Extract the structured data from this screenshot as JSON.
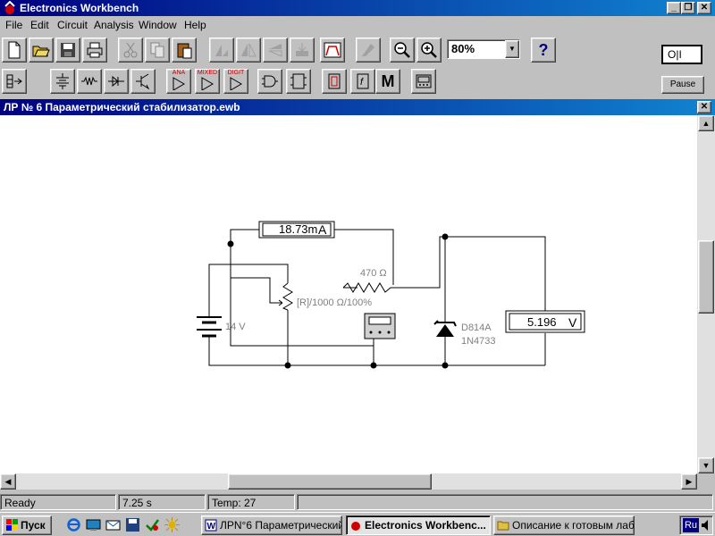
{
  "app": {
    "title": "Electronics Workbench",
    "caption_buttons": [
      "_",
      "❐",
      "✕"
    ]
  },
  "menu": [
    {
      "label": "File",
      "name": "menu-file"
    },
    {
      "label": "Edit",
      "name": "menu-edit"
    },
    {
      "label": "Circuit",
      "name": "menu-circuit"
    },
    {
      "label": "Analysis",
      "name": "menu-analysis"
    },
    {
      "label": "Window",
      "name": "menu-window"
    },
    {
      "label": "Help",
      "name": "menu-help"
    }
  ],
  "toolbar": {
    "zoom_value": "80%",
    "help_label": "?",
    "pause_label": "Pause",
    "power_label": "O|I"
  },
  "parts_bin": {
    "labels": [
      "ANA",
      "MIXED",
      "DIGIT"
    ],
    "m_label": "M"
  },
  "document": {
    "title": "ЛР № 6 Параметрический стабилизатор.ewb",
    "close": "✕"
  },
  "circuit": {
    "ammeter_reading": "18.73m",
    "ammeter_unit": "A",
    "voltmeter_reading": "5.196",
    "voltmeter_unit": "V",
    "battery_label": "14 V",
    "resistor_label": "470 Ω",
    "pot_label": "[R]/1000 Ω/100%",
    "zener_label_1": "D814A",
    "zener_label_2": "1N4733"
  },
  "status": {
    "state": "Ready",
    "time": "7.25 s",
    "temp": "Temp:  27"
  },
  "taskbar": {
    "start_label": "Пуск",
    "tasks": [
      {
        "label": "ЛРN°6 Параметрический...",
        "name": "task-word"
      },
      {
        "label": "Electronics Workbenc...",
        "name": "task-ewb"
      },
      {
        "label": "Описание к готовым лаб...",
        "name": "task-folder"
      }
    ],
    "lang": "Ru"
  },
  "colors": {
    "titlebar": "#000080",
    "wire": "#000000",
    "label_gray": "#808080"
  }
}
